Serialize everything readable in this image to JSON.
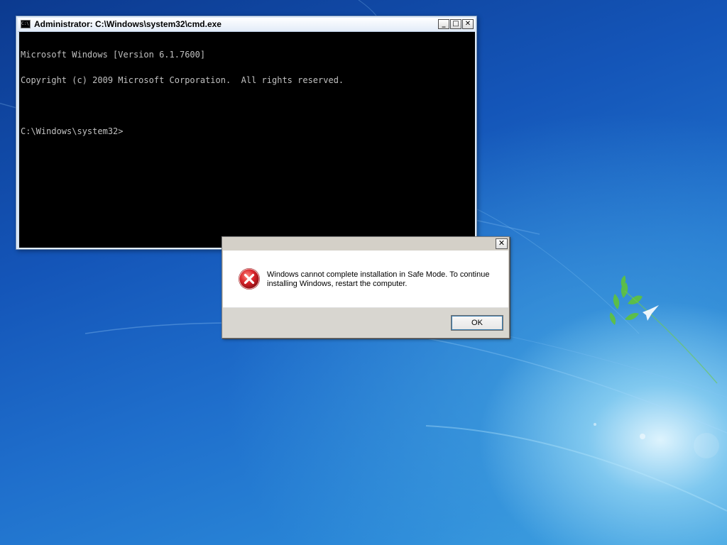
{
  "cmd_window": {
    "title": "Administrator: C:\\Windows\\system32\\cmd.exe",
    "app_icon": "cmd-icon",
    "app_icon_text": "C:\\",
    "buttons": {
      "minimize_icon": "minimize-icon",
      "maximize_icon": "maximize-icon",
      "close_icon": "close-icon",
      "minimize_glyph": "_",
      "maximize_glyph": "□",
      "close_glyph": "✕"
    },
    "console_lines": [
      "Microsoft Windows [Version 6.1.7600]",
      "Copyright (c) 2009 Microsoft Corporation.  All rights reserved.",
      "",
      "C:\\Windows\\system32>"
    ],
    "colors": {
      "background": "#000000",
      "text": "#c0c0c0"
    }
  },
  "error_dialog": {
    "close_glyph": "✕",
    "icon": "error-icon",
    "message": "Windows cannot complete installation in Safe Mode. To continue installing Windows, restart the computer.",
    "ok_label": "OK",
    "colors": {
      "icon_red": "#d8232a",
      "footer": "#d8d6d0"
    }
  },
  "desktop": {
    "wallpaper": "windows-7-harmony-wallpaper",
    "colors": {
      "deep_blue": "#0c3a8f",
      "mid_blue": "#1f6fcc",
      "glow": "#e6f8ff",
      "leaf_green": "#5fc23a"
    }
  }
}
